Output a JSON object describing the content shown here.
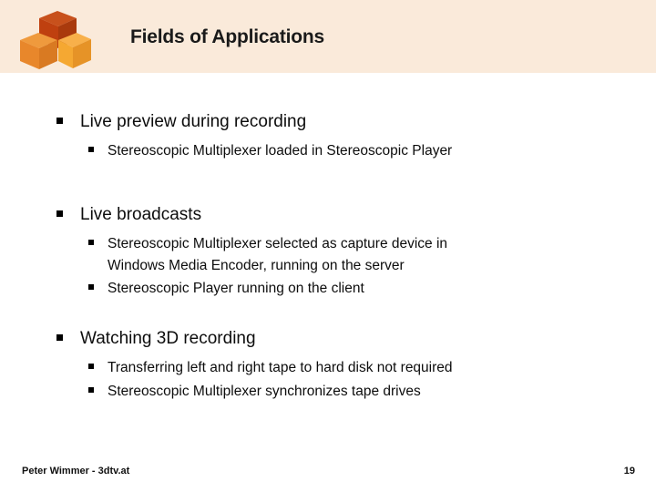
{
  "slide": {
    "title": "Fields of Applications",
    "logo_icon": "three-cubes-logo-icon",
    "header_color": "#faeada",
    "text_color": "#0d0d0d"
  },
  "groups": [
    {
      "heading": "Live preview during recording",
      "items": [
        {
          "lines": [
            "Stereoscopic Multiplexer loaded in Stereoscopic Player"
          ]
        }
      ]
    },
    {
      "heading": "Live broadcasts",
      "items": [
        {
          "lines": [
            "Stereoscopic Multiplexer selected as capture device in",
            "Windows Media Encoder, running on the server"
          ]
        },
        {
          "lines": [
            "Stereoscopic Player running on the client"
          ]
        }
      ]
    },
    {
      "heading": "Watching 3D recording",
      "items": [
        {
          "lines": [
            "Transferring left and right tape to hard disk not required"
          ]
        },
        {
          "lines": [
            "Stereoscopic Multiplexer synchronizes tape drives"
          ]
        }
      ]
    }
  ],
  "footer": {
    "author": "Peter Wimmer - 3dtv.at",
    "page_number": "19"
  }
}
